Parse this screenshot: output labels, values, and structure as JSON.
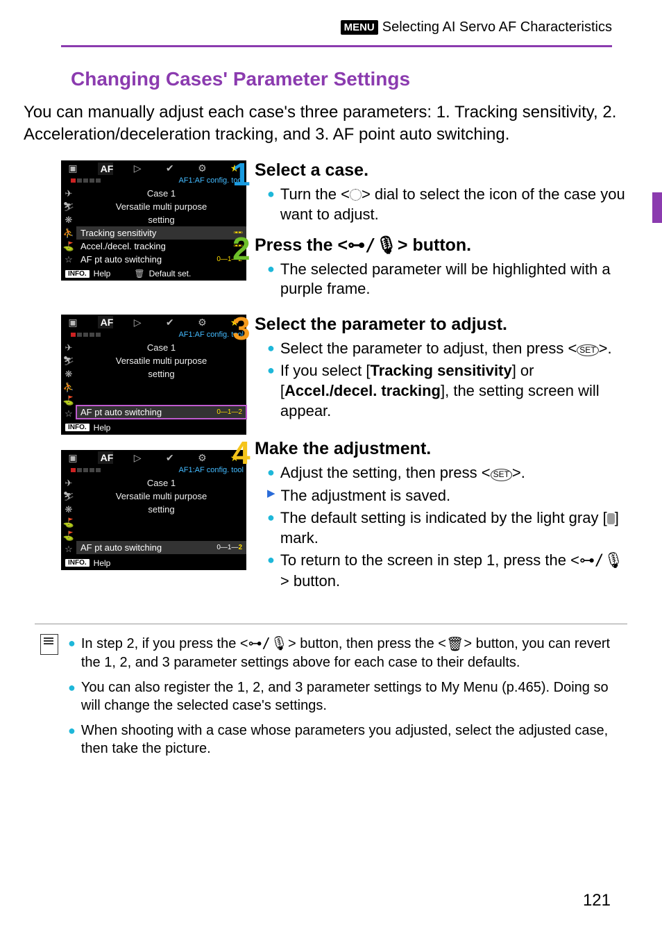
{
  "header": {
    "menu_label": "MENU",
    "text": " Selecting AI Servo AF Characteristics"
  },
  "section_title": "Changing Cases' Parameter Settings",
  "intro": "You can manually adjust each case's three parameters: 1. Tracking sensitivity, 2. Acceleration/deceleration tracking, and 3. AF point auto switching.",
  "screens": {
    "tab_af": "AF",
    "config_label": "AF1:AF config. tool",
    "case_label": "Case 1",
    "desc1": "Versatile multi purpose",
    "desc2": "setting",
    "param_track": "Tracking sensitivity",
    "param_accel": "Accel./decel. tracking",
    "param_afpt": "AF pt auto switching",
    "info": "INFO.",
    "help": "Help",
    "default": "Default set."
  },
  "steps": {
    "s1": {
      "title": "Select a case.",
      "b1a": "Turn the <",
      "b1b": "> dial to select the icon of the case you want to adjust."
    },
    "s2": {
      "title_a": "Press the <",
      "title_b": "> button.",
      "b1": "The selected parameter will be highlighted with a purple frame."
    },
    "s3": {
      "title": "Select the parameter to adjust.",
      "b1a": "Select the parameter to adjust, then press <",
      "b1b": ">.",
      "b2a": "If you select [",
      "b2b": "Tracking sensitivity",
      "b2c": "] or [",
      "b2d": "Accel./decel. tracking",
      "b2e": "], the setting screen will appear."
    },
    "s4": {
      "title": "Make the adjustment.",
      "b1a": "Adjust the setting, then press <",
      "b1b": ">.",
      "b2": "The adjustment is saved.",
      "b3a": "The default setting is indicated by the light gray [",
      "b3b": "] mark.",
      "b4a": "To return to the screen in step 1, press the <",
      "b4b": "> button."
    }
  },
  "rate_glyph": "⊶/🎙",
  "notes": {
    "n1a": "In step 2, if you press the <",
    "n1b": "> button, then press the <",
    "n1c": "> button, you can revert the 1, 2, and 3 parameter settings above for each case to their defaults.",
    "n2": "You can also register the 1, 2, and 3 parameter settings to My Menu (p.465). Doing so will change the selected case's settings.",
    "n3": "When shooting with a case whose parameters you adjusted, select the adjusted case, then take the picture."
  },
  "page_number": "121"
}
